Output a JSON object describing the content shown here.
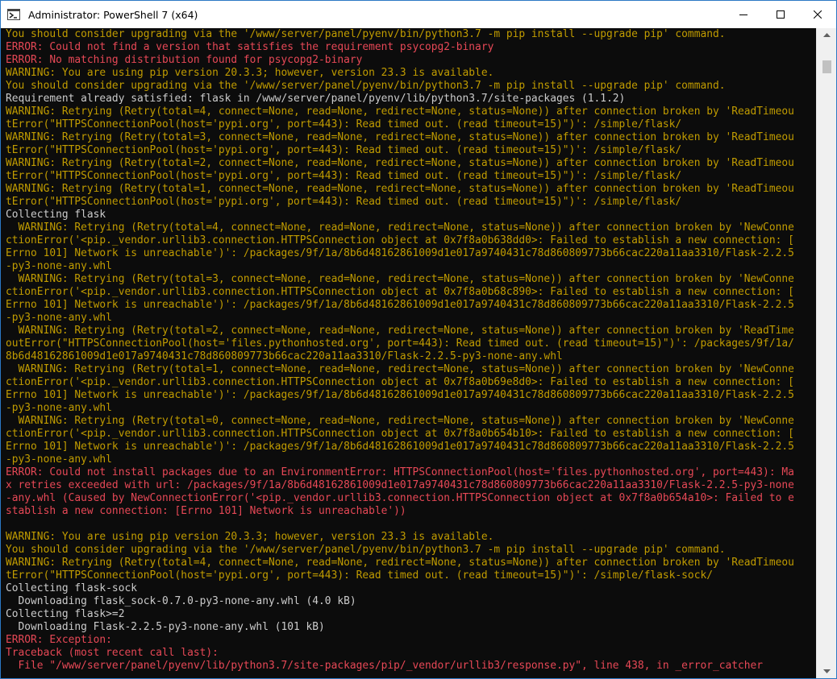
{
  "window": {
    "title": "Administrator: PowerShell 7 (x64)"
  },
  "colors": {
    "default": "#cccccc",
    "warning": "#c19c00",
    "error": "#e74856",
    "errorDark": "#c50f1f",
    "background": "#0c0c0c"
  },
  "icons": {
    "app": "powershell-icon",
    "minimize": "minimize-icon",
    "maximize": "maximize-icon",
    "close": "close-icon",
    "scrollUp": "scroll-up-arrow-icon",
    "scrollDown": "scroll-down-arrow-icon"
  },
  "console_lines": [
    {
      "text": "You should consider upgrading via the '/www/server/panel/pyenv/bin/python3.7 -m pip install --upgrade pip' command.",
      "kind": "warning"
    },
    {
      "text": "ERROR: Could not find a version that satisfies the requirement psycopg2-binary",
      "kind": "error"
    },
    {
      "text": "ERROR: No matching distribution found for psycopg2-binary",
      "kind": "error"
    },
    {
      "text": "WARNING: You are using pip version 20.3.3; however, version 23.3 is available.",
      "kind": "warning"
    },
    {
      "text": "You should consider upgrading via the '/www/server/panel/pyenv/bin/python3.7 -m pip install --upgrade pip' command.",
      "kind": "warning"
    },
    {
      "text": "Requirement already satisfied: flask in /www/server/panel/pyenv/lib/python3.7/site-packages (1.1.2)",
      "kind": "default"
    },
    {
      "text": "WARNING: Retrying (Retry(total=4, connect=None, read=None, redirect=None, status=None)) after connection broken by 'ReadTimeou",
      "kind": "warning"
    },
    {
      "text": "tError(\"HTTPSConnectionPool(host='pypi.org', port=443): Read timed out. (read timeout=15)\")': /simple/flask/",
      "kind": "warning"
    },
    {
      "text": "WARNING: Retrying (Retry(total=3, connect=None, read=None, redirect=None, status=None)) after connection broken by 'ReadTimeou",
      "kind": "warning"
    },
    {
      "text": "tError(\"HTTPSConnectionPool(host='pypi.org', port=443): Read timed out. (read timeout=15)\")': /simple/flask/",
      "kind": "warning"
    },
    {
      "text": "WARNING: Retrying (Retry(total=2, connect=None, read=None, redirect=None, status=None)) after connection broken by 'ReadTimeou",
      "kind": "warning"
    },
    {
      "text": "tError(\"HTTPSConnectionPool(host='pypi.org', port=443): Read timed out. (read timeout=15)\")': /simple/flask/",
      "kind": "warning"
    },
    {
      "text": "WARNING: Retrying (Retry(total=1, connect=None, read=None, redirect=None, status=None)) after connection broken by 'ReadTimeou",
      "kind": "warning"
    },
    {
      "text": "tError(\"HTTPSConnectionPool(host='pypi.org', port=443): Read timed out. (read timeout=15)\")': /simple/flask/",
      "kind": "warning"
    },
    {
      "text": "Collecting flask",
      "kind": "default"
    },
    {
      "text": "  WARNING: Retrying (Retry(total=4, connect=None, read=None, redirect=None, status=None)) after connection broken by 'NewConne",
      "kind": "warning"
    },
    {
      "text": "ctionError('<pip._vendor.urllib3.connection.HTTPSConnection object at 0x7f8a0b638dd0>: Failed to establish a new connection: [",
      "kind": "warning"
    },
    {
      "text": "Errno 101] Network is unreachable')': /packages/9f/1a/8b6d48162861009d1e017a9740431c78d860809773b66cac220a11aa3310/Flask-2.2.5",
      "kind": "warning"
    },
    {
      "text": "-py3-none-any.whl",
      "kind": "warning"
    },
    {
      "text": "  WARNING: Retrying (Retry(total=3, connect=None, read=None, redirect=None, status=None)) after connection broken by 'NewConne",
      "kind": "warning"
    },
    {
      "text": "ctionError('<pip._vendor.urllib3.connection.HTTPSConnection object at 0x7f8a0b68c890>: Failed to establish a new connection: [",
      "kind": "warning"
    },
    {
      "text": "Errno 101] Network is unreachable')': /packages/9f/1a/8b6d48162861009d1e017a9740431c78d860809773b66cac220a11aa3310/Flask-2.2.5",
      "kind": "warning"
    },
    {
      "text": "-py3-none-any.whl",
      "kind": "warning"
    },
    {
      "text": "  WARNING: Retrying (Retry(total=2, connect=None, read=None, redirect=None, status=None)) after connection broken by 'ReadTime",
      "kind": "warning"
    },
    {
      "text": "outError(\"HTTPSConnectionPool(host='files.pythonhosted.org', port=443): Read timed out. (read timeout=15)\")': /packages/9f/1a/",
      "kind": "warning"
    },
    {
      "text": "8b6d48162861009d1e017a9740431c78d860809773b66cac220a11aa3310/Flask-2.2.5-py3-none-any.whl",
      "kind": "warning"
    },
    {
      "text": "  WARNING: Retrying (Retry(total=1, connect=None, read=None, redirect=None, status=None)) after connection broken by 'NewConne",
      "kind": "warning"
    },
    {
      "text": "ctionError('<pip._vendor.urllib3.connection.HTTPSConnection object at 0x7f8a0b69e8d0>: Failed to establish a new connection: [",
      "kind": "warning"
    },
    {
      "text": "Errno 101] Network is unreachable')': /packages/9f/1a/8b6d48162861009d1e017a9740431c78d860809773b66cac220a11aa3310/Flask-2.2.5",
      "kind": "warning"
    },
    {
      "text": "-py3-none-any.whl",
      "kind": "warning"
    },
    {
      "text": "  WARNING: Retrying (Retry(total=0, connect=None, read=None, redirect=None, status=None)) after connection broken by 'NewConne",
      "kind": "warning"
    },
    {
      "text": "ctionError('<pip._vendor.urllib3.connection.HTTPSConnection object at 0x7f8a0b654b10>: Failed to establish a new connection: [",
      "kind": "warning"
    },
    {
      "text": "Errno 101] Network is unreachable')': /packages/9f/1a/8b6d48162861009d1e017a9740431c78d860809773b66cac220a11aa3310/Flask-2.2.5",
      "kind": "warning"
    },
    {
      "text": "-py3-none-any.whl",
      "kind": "warning"
    },
    {
      "text": "ERROR: Could not install packages due to an EnvironmentError: HTTPSConnectionPool(host='files.pythonhosted.org', port=443): Ma",
      "kind": "error"
    },
    {
      "text": "x retries exceeded with url: /packages/9f/1a/8b6d48162861009d1e017a9740431c78d860809773b66cac220a11aa3310/Flask-2.2.5-py3-none",
      "kind": "error"
    },
    {
      "text": "-any.whl (Caused by NewConnectionError('<pip._vendor.urllib3.connection.HTTPSConnection object at 0x7f8a0b654a10>: Failed to e",
      "kind": "error"
    },
    {
      "text": "stablish a new connection: [Errno 101] Network is unreachable'))",
      "kind": "error"
    },
    {
      "text": "",
      "kind": "default"
    },
    {
      "text": "WARNING: You are using pip version 20.3.3; however, version 23.3 is available.",
      "kind": "warning"
    },
    {
      "text": "You should consider upgrading via the '/www/server/panel/pyenv/bin/python3.7 -m pip install --upgrade pip' command.",
      "kind": "warning"
    },
    {
      "text": "WARNING: Retrying (Retry(total=4, connect=None, read=None, redirect=None, status=None)) after connection broken by 'ReadTimeou",
      "kind": "warning"
    },
    {
      "text": "tError(\"HTTPSConnectionPool(host='pypi.org', port=443): Read timed out. (read timeout=15)\")': /simple/flask-sock/",
      "kind": "warning"
    },
    {
      "text": "Collecting flask-sock",
      "kind": "default"
    },
    {
      "text": "  Downloading flask_sock-0.7.0-py3-none-any.whl (4.0 kB)",
      "kind": "default"
    },
    {
      "text": "Collecting flask>=2",
      "kind": "default"
    },
    {
      "text": "  Downloading Flask-2.2.5-py3-none-any.whl (101 kB)",
      "kind": "default"
    },
    {
      "text": "ERROR: Exception:",
      "kind": "error"
    },
    {
      "text": "Traceback (most recent call last):",
      "kind": "error"
    },
    {
      "text": "  File \"/www/server/panel/pyenv/lib/python3.7/site-packages/pip/_vendor/urllib3/response.py\", line 438, in _error_catcher",
      "kind": "error"
    }
  ]
}
